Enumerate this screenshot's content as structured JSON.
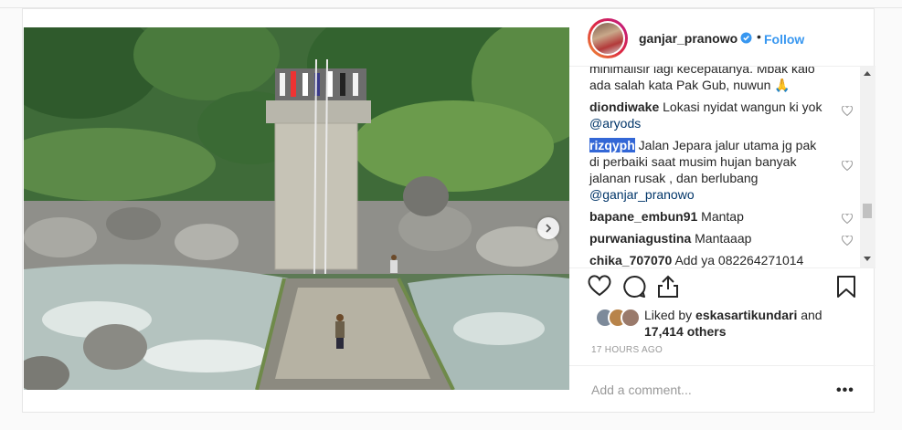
{
  "post": {
    "username": "ganjar_pranowo",
    "follow_label": "Follow",
    "separator": "•"
  },
  "comments": [
    {
      "text": "minimalisir lagi kecepatanya. Mbak kalo"
    },
    {
      "text": "ada salah kata Pak Gub, nuwun 🙏"
    },
    {
      "user": "diondiwake",
      "text": "Lokasi nyidat wangun ki yok",
      "mention": "@aryods"
    },
    {
      "user": "rizqyph",
      "text_lines": [
        "Jalan Jepara jalur utama jg pak",
        "di perbaiki saat musim hujan banyak",
        "jalanan rusak , dan berlubang"
      ],
      "mention": "@ganjar_pranowo"
    },
    {
      "user": "bapane_embun91",
      "text": "Mantap"
    },
    {
      "user": "purwaniagustina",
      "text": "Mantaaap"
    },
    {
      "user": "chika_707070",
      "text": "Add ya 082264271014"
    }
  ],
  "likes": {
    "prefix": "Liked by",
    "user": "eskasartikundari",
    "and": "and",
    "count": "17,414 others"
  },
  "timestamp": "17 HOURS AGO",
  "add_comment_placeholder": "Add a comment...",
  "more_label": "•••",
  "colors": {
    "accent": "#3897f0",
    "verified": "#3897f0",
    "text": "#262626",
    "muted": "#999999"
  },
  "icons": [
    "heart-icon",
    "comment-icon",
    "share-icon",
    "bookmark-icon",
    "verified-icon",
    "chevron-right-icon"
  ]
}
